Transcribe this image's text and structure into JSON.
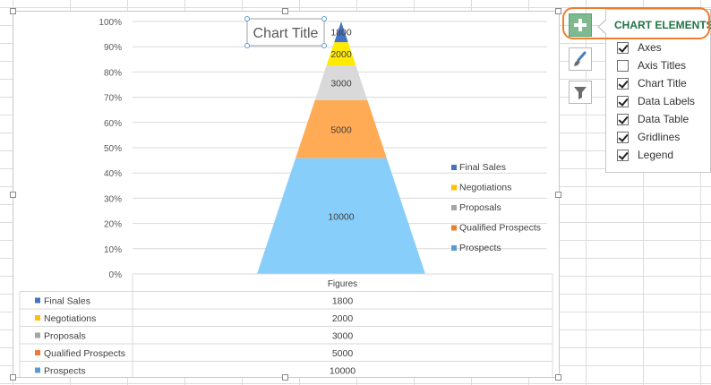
{
  "chart": {
    "title": "Chart Title",
    "y_axis_ticks": [
      "0%",
      "10%",
      "20%",
      "30%",
      "40%",
      "50%",
      "60%",
      "70%",
      "80%",
      "90%",
      "100%"
    ],
    "data_table_header": "Figures",
    "stages": [
      {
        "name": "Final Sales",
        "value_label": "1800",
        "color": "#4472c4"
      },
      {
        "name": "Negotiations",
        "value_label": "2000",
        "color": "#ffc000"
      },
      {
        "name": "Proposals",
        "value_label": "3000",
        "color": "#a5a5a5"
      },
      {
        "name": "Qualified Prospects",
        "value_label": "5000",
        "color": "#ed7d31"
      },
      {
        "name": "Prospects",
        "value_label": "10000",
        "color": "#5b9bd5"
      }
    ],
    "legend_order": [
      "Final Sales",
      "Negotiations",
      "Proposals",
      "Qualified Prospects",
      "Prospects"
    ]
  },
  "chart_data": {
    "type": "area",
    "title": "Chart Title",
    "categories": [
      "Final Sales",
      "Negotiations",
      "Proposals",
      "Qualified Prospects",
      "Prospects"
    ],
    "series": [
      {
        "name": "Figures",
        "values": [
          1800,
          2000,
          3000,
          5000,
          10000
        ]
      }
    ],
    "ylim": [
      0,
      1
    ],
    "ylabel": "",
    "xlabel": "",
    "grid": true,
    "legend": "right"
  },
  "segment_fills": [
    "#4472c4",
    "#ffea00",
    "#d9d9d9",
    "#ffaa55",
    "#87cefa"
  ],
  "side_buttons": [
    {
      "name": "chart-elements-button",
      "icon": "plus-icon"
    },
    {
      "name": "chart-styles-button",
      "icon": "brush-icon"
    },
    {
      "name": "chart-filters-button",
      "icon": "filter-icon"
    }
  ],
  "panel": {
    "title": "CHART ELEMENTS",
    "items": [
      {
        "label": "Axes",
        "checked": true
      },
      {
        "label": "Axis Titles",
        "checked": false
      },
      {
        "label": "Chart Title",
        "checked": true
      },
      {
        "label": "Data Labels",
        "checked": true
      },
      {
        "label": "Data Table",
        "checked": true
      },
      {
        "label": "Gridlines",
        "checked": true
      },
      {
        "label": "Legend",
        "checked": true
      }
    ]
  }
}
